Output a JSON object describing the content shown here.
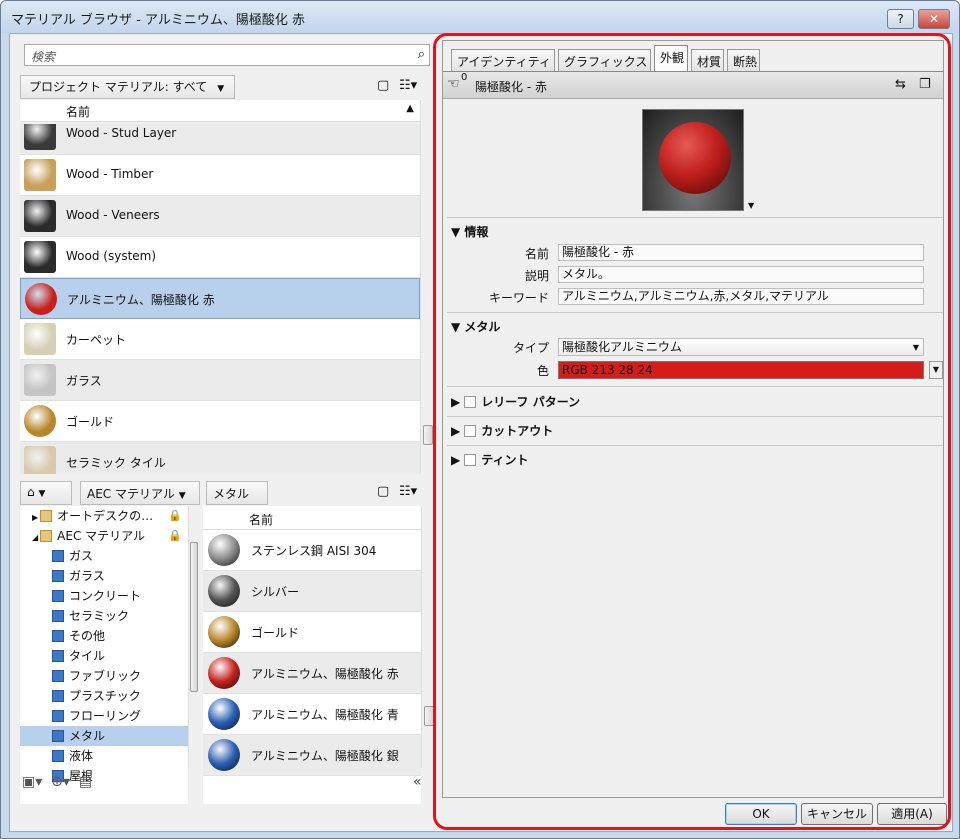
{
  "window": {
    "title": "マテリアル ブラウザ - アルミニウム、陽極酸化 赤",
    "help": "?",
    "close": "✕"
  },
  "search": {
    "placeholder": "検索"
  },
  "project": {
    "crumb": "プロジェクト マテリアル: すべて",
    "column": "名前",
    "items": [
      {
        "name": "Wood - Stud Layer",
        "swatch": "#3a3a3a"
      },
      {
        "name": "Wood - Timber",
        "swatch": "#c9a05a"
      },
      {
        "name": "Wood - Veneers",
        "swatch": "#2b2b2b"
      },
      {
        "name": "Wood (system)",
        "swatch": "#2b2b2b"
      },
      {
        "name": "アルミニウム、陽極酸化 赤",
        "swatch": "#c8201c"
      },
      {
        "name": "カーペット",
        "swatch": "#d5d0b5"
      },
      {
        "name": "ガラス",
        "swatch": "#c4c4c4"
      },
      {
        "name": "ゴールド",
        "swatch": "#b8862a"
      },
      {
        "name": "セラミック タイル",
        "swatch": "#d9c9ad"
      }
    ]
  },
  "library": {
    "crumbs": [
      "AEC マテリアル",
      "メタル"
    ],
    "column": "名前",
    "tree": [
      {
        "label": "オートデスクの…",
        "kind": "folder",
        "lock": "🔒"
      },
      {
        "label": "AEC マテリアル",
        "kind": "folder",
        "lock": "🔒"
      },
      {
        "label": "ガス",
        "kind": "cat"
      },
      {
        "label": "ガラス",
        "kind": "cat"
      },
      {
        "label": "コンクリート",
        "kind": "cat"
      },
      {
        "label": "セラミック",
        "kind": "cat"
      },
      {
        "label": "その他",
        "kind": "cat"
      },
      {
        "label": "タイル",
        "kind": "cat"
      },
      {
        "label": "ファブリック",
        "kind": "cat"
      },
      {
        "label": "プラスチック",
        "kind": "cat"
      },
      {
        "label": "フローリング",
        "kind": "cat"
      },
      {
        "label": "メタル",
        "kind": "cat"
      },
      {
        "label": "液体",
        "kind": "cat"
      },
      {
        "label": "屋根",
        "kind": "cat"
      }
    ],
    "items": [
      {
        "name": "ステンレス鋼 AISI 304",
        "swatch": "#8c8c8c"
      },
      {
        "name": "シルバー",
        "swatch": "#555555"
      },
      {
        "name": "ゴールド",
        "swatch": "#b8862a"
      },
      {
        "name": "アルミニウム、陽極酸化 赤",
        "swatch": "#c8201c"
      },
      {
        "name": "アルミニウム、陽極酸化 青",
        "swatch": "#2a5fb5"
      },
      {
        "name": "アルミニウム、陽極酸化 銀",
        "swatch": "#2a5fb5"
      }
    ]
  },
  "tabs": [
    "アイデンティティ",
    "グラフィックス",
    "外観",
    "材質",
    "断熱"
  ],
  "asset": {
    "count": "0",
    "name": "陽極酸化 - 赤"
  },
  "info": {
    "heading": "情報",
    "name_label": "名前",
    "name_value": "陽極酸化 - 赤",
    "desc_label": "説明",
    "desc_value": "メタル。",
    "keyword_label": "キーワード",
    "keyword_value": "アルミニウム,アルミニウム,赤,メタル,マテリアル"
  },
  "metal": {
    "heading": "メタル",
    "type_label": "タイプ",
    "type_value": "陽極酸化アルミニウム",
    "color_label": "色",
    "color_value": "RGB 213 28 24",
    "color_hex": "#d51c18"
  },
  "collapsed": [
    "レリーフ パターン",
    "カットアウト",
    "ティント"
  ],
  "buttons": {
    "ok": "OK",
    "cancel": "キャンセル",
    "apply": "適用(A)"
  }
}
